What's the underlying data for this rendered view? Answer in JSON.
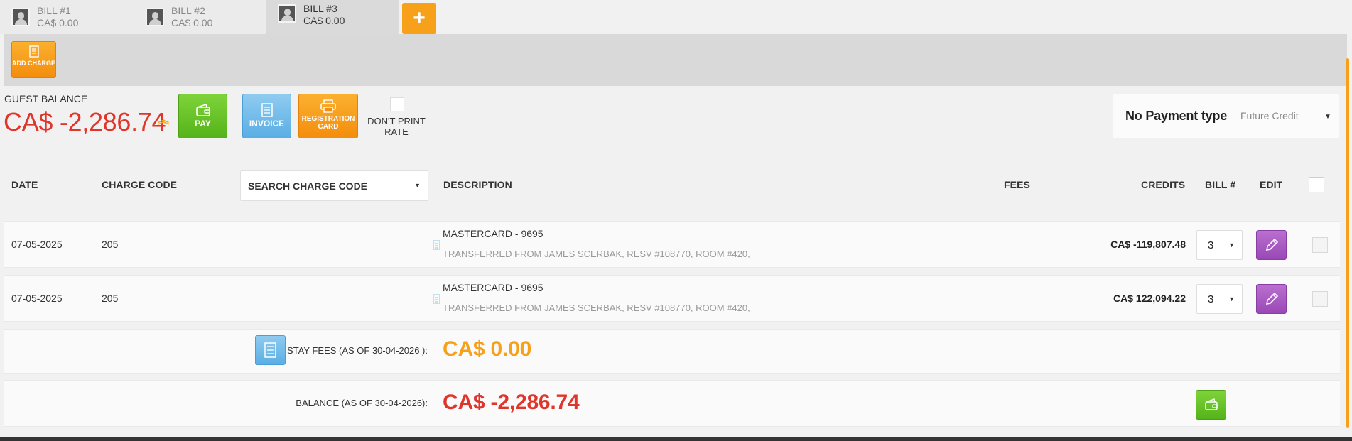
{
  "tabs": [
    {
      "title": "BILL #1",
      "amount": "CA$ 0.00"
    },
    {
      "title": "BILL #2",
      "amount": "CA$ 0.00"
    },
    {
      "title": "BILL #3",
      "amount": "CA$ 0.00"
    }
  ],
  "tab_add_label": "+",
  "toolbar": {
    "add_charge_label": "ADD CHARGE"
  },
  "guest_balance": {
    "label": "GUEST BALANCE",
    "amount": "CA$ -2,286.74"
  },
  "actions": {
    "pay_label": "PAY",
    "invoice_label": "INVOICE",
    "registration_card_label": "REGISTRATION CARD",
    "dont_print_rate_label": "DON'T PRINT RATE"
  },
  "payment": {
    "title": "No Payment type",
    "selected": "Future Credit"
  },
  "table": {
    "headers": {
      "date": "DATE",
      "charge_code": "CHARGE CODE",
      "search_charge_code": "SEARCH CHARGE CODE",
      "description": "DESCRIPTION",
      "fees": "FEES",
      "credits": "CREDITS",
      "bill_no": "BILL #",
      "edit": "EDIT"
    },
    "rows": [
      {
        "date": "07-05-2025",
        "charge_code": "205",
        "description": "MASTERCARD - 9695",
        "note": "TRANSFERRED FROM JAMES SCERBAK, RESV #108770, ROOM #420,",
        "credits": "CA$ -119,807.48",
        "bill": "3"
      },
      {
        "date": "07-05-2025",
        "charge_code": "205",
        "description": "MASTERCARD - 9695",
        "note": "TRANSFERRED FROM JAMES SCERBAK, RESV #108770, ROOM #420,",
        "credits": "CA$ 122,094.22",
        "bill": "3"
      }
    ]
  },
  "stay_fees": {
    "label": "STAY FEES (AS OF  30-04-2026 ):",
    "amount": "CA$ 0.00"
  },
  "balance": {
    "label": "BALANCE (AS OF  30-04-2026):",
    "amount": "CA$ -2,286.74"
  },
  "colors": {
    "accent_orange": "#f7a11a",
    "balance_red": "#e0352b",
    "pay_green": "#5cb91f",
    "invoice_blue": "#5aaee4",
    "edit_purple": "#9a48b6"
  }
}
